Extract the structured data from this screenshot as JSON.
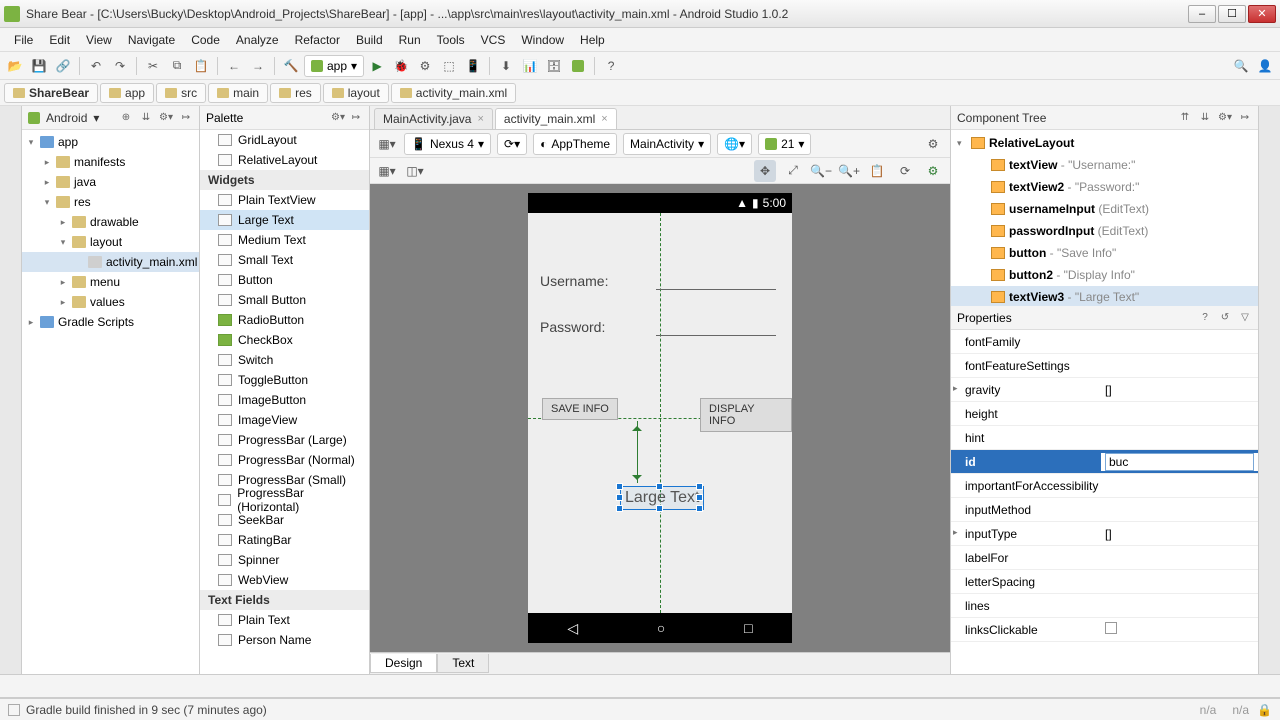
{
  "window": {
    "title": "Share Bear - [C:\\Users\\Bucky\\Desktop\\Android_Projects\\ShareBear] - [app] - ...\\app\\src\\main\\res\\layout\\activity_main.xml - Android Studio 1.0.2"
  },
  "menu": [
    "File",
    "Edit",
    "View",
    "Navigate",
    "Code",
    "Analyze",
    "Refactor",
    "Build",
    "Run",
    "Tools",
    "VCS",
    "Window",
    "Help"
  ],
  "run_config": "app",
  "breadcrumbs": [
    "ShareBear",
    "app",
    "src",
    "main",
    "res",
    "layout",
    "activity_main.xml"
  ],
  "project_panel": {
    "header": "Android",
    "tree": [
      {
        "indent": 0,
        "exp": "▾",
        "icon": "mod",
        "label": "app"
      },
      {
        "indent": 1,
        "exp": "▸",
        "icon": "folder",
        "label": "manifests"
      },
      {
        "indent": 1,
        "exp": "▸",
        "icon": "folder",
        "label": "java"
      },
      {
        "indent": 1,
        "exp": "▾",
        "icon": "folder",
        "label": "res"
      },
      {
        "indent": 2,
        "exp": "▸",
        "icon": "folder",
        "label": "drawable"
      },
      {
        "indent": 2,
        "exp": "▾",
        "icon": "folder",
        "label": "layout"
      },
      {
        "indent": 3,
        "exp": " ",
        "icon": "file",
        "label": "activity_main.xml",
        "sel": true
      },
      {
        "indent": 2,
        "exp": "▸",
        "icon": "folder",
        "label": "menu"
      },
      {
        "indent": 2,
        "exp": "▸",
        "icon": "folder",
        "label": "values"
      },
      {
        "indent": 0,
        "exp": "▸",
        "icon": "mod",
        "label": "Gradle Scripts"
      }
    ]
  },
  "editor_tabs": [
    {
      "label": "MainActivity.java",
      "active": false
    },
    {
      "label": "activity_main.xml",
      "active": true
    }
  ],
  "palette": {
    "header": "Palette",
    "items": [
      {
        "type": "item",
        "label": "GridLayout"
      },
      {
        "type": "item",
        "label": "RelativeLayout"
      },
      {
        "type": "cat",
        "label": "Widgets"
      },
      {
        "type": "item",
        "label": "Plain TextView"
      },
      {
        "type": "item",
        "label": "Large Text",
        "sel": true
      },
      {
        "type": "item",
        "label": "Medium Text"
      },
      {
        "type": "item",
        "label": "Small Text"
      },
      {
        "type": "item",
        "label": "Button"
      },
      {
        "type": "item",
        "label": "Small Button"
      },
      {
        "type": "item",
        "label": "RadioButton",
        "green": true
      },
      {
        "type": "item",
        "label": "CheckBox",
        "green": true
      },
      {
        "type": "item",
        "label": "Switch"
      },
      {
        "type": "item",
        "label": "ToggleButton"
      },
      {
        "type": "item",
        "label": "ImageButton"
      },
      {
        "type": "item",
        "label": "ImageView"
      },
      {
        "type": "item",
        "label": "ProgressBar (Large)"
      },
      {
        "type": "item",
        "label": "ProgressBar (Normal)"
      },
      {
        "type": "item",
        "label": "ProgressBar (Small)"
      },
      {
        "type": "item",
        "label": "ProgressBar (Horizontal)"
      },
      {
        "type": "item",
        "label": "SeekBar"
      },
      {
        "type": "item",
        "label": "RatingBar"
      },
      {
        "type": "item",
        "label": "Spinner"
      },
      {
        "type": "item",
        "label": "WebView"
      },
      {
        "type": "cat",
        "label": "Text Fields"
      },
      {
        "type": "item",
        "label": "Plain Text"
      },
      {
        "type": "item",
        "label": "Person Name"
      }
    ]
  },
  "design_toolbar": {
    "device": "Nexus 4",
    "theme": "AppTheme",
    "activity": "MainActivity",
    "api": "21"
  },
  "preview": {
    "time": "5:00",
    "labels": {
      "username": "Username:",
      "password": "Password:"
    },
    "buttons": {
      "save": "SAVE INFO",
      "display": "DISPLAY INFO"
    },
    "selected_text": "Large Text"
  },
  "bottom_tabs": [
    "Design",
    "Text"
  ],
  "component_tree": {
    "header": "Component Tree",
    "nodes": [
      {
        "indent": 0,
        "exp": "▾",
        "name": "RelativeLayout",
        "extra": ""
      },
      {
        "indent": 1,
        "exp": " ",
        "name": "textView",
        "extra": " - \"Username:\""
      },
      {
        "indent": 1,
        "exp": " ",
        "name": "textView2",
        "extra": " - \"Password:\""
      },
      {
        "indent": 1,
        "exp": " ",
        "name": "usernameInput",
        "extra": " (EditText)"
      },
      {
        "indent": 1,
        "exp": " ",
        "name": "passwordInput",
        "extra": " (EditText)"
      },
      {
        "indent": 1,
        "exp": " ",
        "name": "button",
        "extra": " - \"Save Info\""
      },
      {
        "indent": 1,
        "exp": " ",
        "name": "button2",
        "extra": " - \"Display Info\""
      },
      {
        "indent": 1,
        "exp": " ",
        "name": "textView3",
        "extra": " - \"Large Text\"",
        "sel": true
      }
    ]
  },
  "properties": {
    "header": "Properties",
    "rows": [
      {
        "k": "fontFamily",
        "v": ""
      },
      {
        "k": "fontFeatureSettings",
        "v": ""
      },
      {
        "k": "gravity",
        "v": "[]",
        "exp": "▸"
      },
      {
        "k": "height",
        "v": ""
      },
      {
        "k": "hint",
        "v": ""
      },
      {
        "k": "id",
        "v": "buc",
        "edit": true,
        "sel": true
      },
      {
        "k": "importantForAccessibility",
        "v": ""
      },
      {
        "k": "inputMethod",
        "v": ""
      },
      {
        "k": "inputType",
        "v": "[]",
        "exp": "▸"
      },
      {
        "k": "labelFor",
        "v": ""
      },
      {
        "k": "letterSpacing",
        "v": ""
      },
      {
        "k": "lines",
        "v": ""
      },
      {
        "k": "linksClickable",
        "v": "",
        "check": true
      }
    ]
  },
  "status": {
    "message": "Gradle build finished in 9 sec (7 minutes ago)",
    "na": "n/a"
  }
}
